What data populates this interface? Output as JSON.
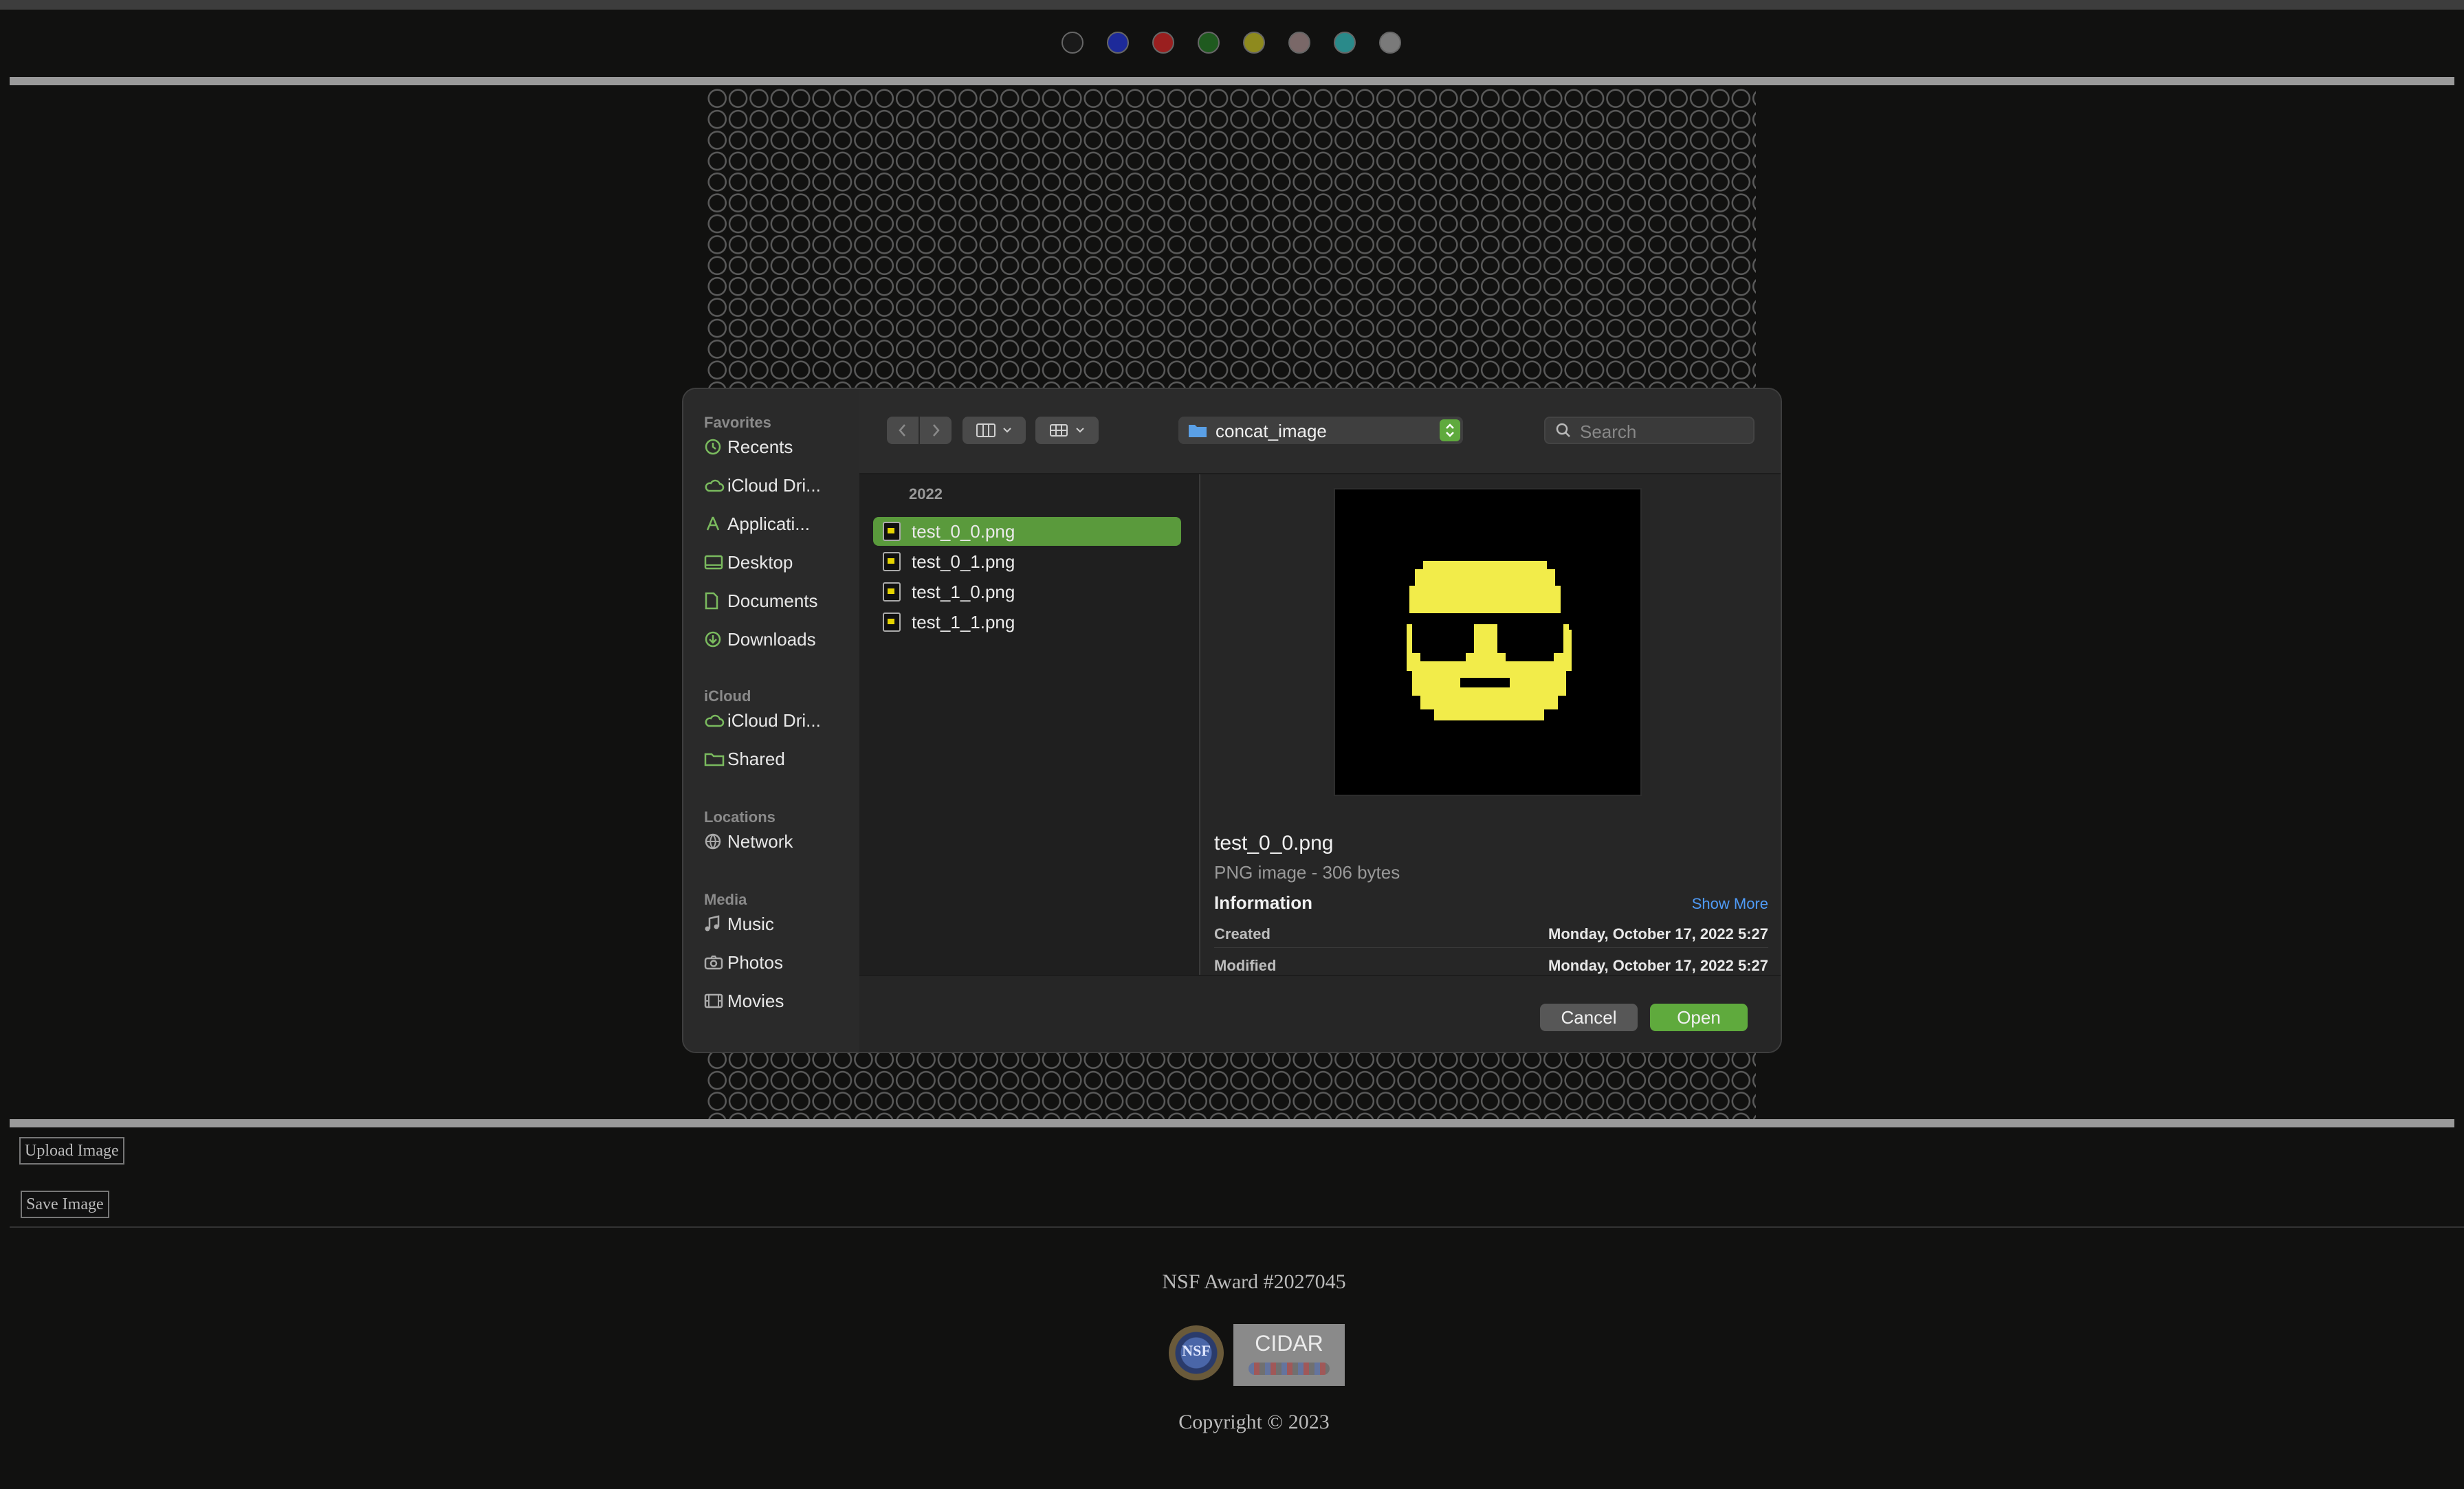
{
  "palette": {
    "colors": [
      "#1a1a1a",
      "#1d2a9a",
      "#9a1f1f",
      "#1f5a1f",
      "#8e8a1e",
      "#7a6868",
      "#2a8a8a",
      "#7a7a7a"
    ]
  },
  "dialog": {
    "sidebar": {
      "favorites_label": "Favorites",
      "favorites": [
        {
          "label": "Recents",
          "icon": "clock-icon"
        },
        {
          "label": "iCloud Dri...",
          "icon": "cloud-icon"
        },
        {
          "label": "Applicati...",
          "icon": "applications-icon"
        },
        {
          "label": "Desktop",
          "icon": "desktop-icon"
        },
        {
          "label": "Documents",
          "icon": "document-icon"
        },
        {
          "label": "Downloads",
          "icon": "download-icon"
        }
      ],
      "icloud_label": "iCloud",
      "icloud": [
        {
          "label": "iCloud Dri...",
          "icon": "cloud-icon"
        },
        {
          "label": "Shared",
          "icon": "shared-folder-icon"
        }
      ],
      "locations_label": "Locations",
      "locations": [
        {
          "label": "Network",
          "icon": "network-icon"
        }
      ],
      "media_label": "Media",
      "media": [
        {
          "label": "Music",
          "icon": "music-icon"
        },
        {
          "label": "Photos",
          "icon": "camera-icon"
        },
        {
          "label": "Movies",
          "icon": "film-icon"
        }
      ]
    },
    "toolbar": {
      "folder_name": "concat_image",
      "search_placeholder": "Search"
    },
    "files": {
      "group": "2022",
      "items": [
        "test_0_0.png",
        "test_0_1.png",
        "test_1_0.png",
        "test_1_1.png"
      ],
      "selected": "test_0_0.png"
    },
    "preview": {
      "name": "test_0_0.png",
      "kind": "PNG image - 306 bytes",
      "info_heading": "Information",
      "show_more": "Show More",
      "created_label": "Created",
      "created_value": "Monday, October 17, 2022 5:27",
      "modified_label": "Modified",
      "modified_value": "Monday, October 17, 2022 5:27"
    },
    "buttons": {
      "cancel": "Cancel",
      "open": "Open"
    }
  },
  "page": {
    "upload_label": "Upload Image",
    "save_label": "Save Image",
    "award": "NSF Award #2027045",
    "nsf_logo_text": "NSF",
    "cidar_logo_text": "CIDAR",
    "copyright": "Copyright © 2023"
  }
}
